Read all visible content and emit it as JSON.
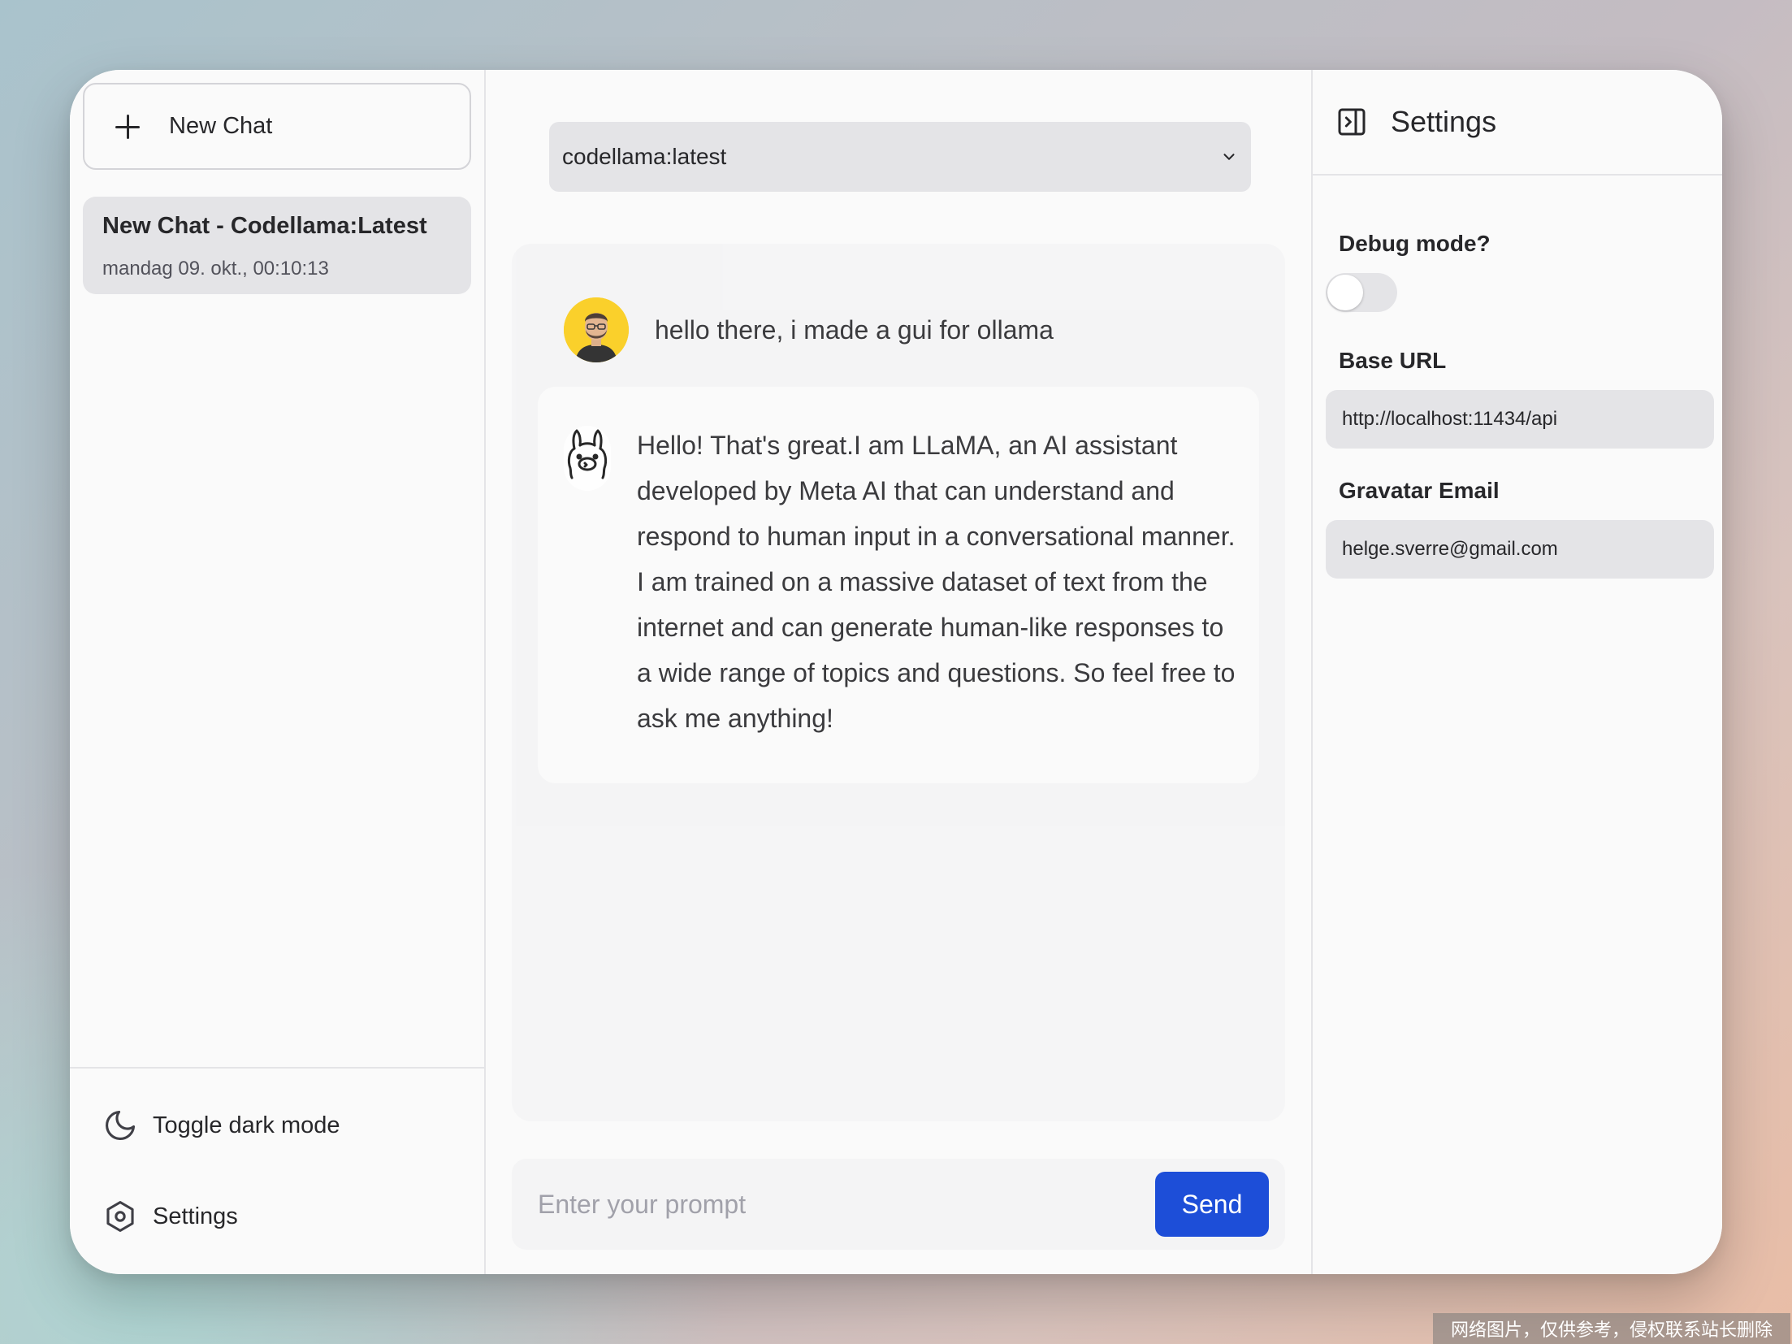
{
  "sidebar": {
    "new_chat_label": "New Chat",
    "chats": [
      {
        "title": "New Chat - Codellama:Latest",
        "date": "mandag 09. okt., 00:10:13"
      }
    ],
    "toggle_dark_label": "Toggle dark mode",
    "settings_label": "Settings"
  },
  "main": {
    "model": "codellama:latest",
    "messages": [
      {
        "role": "user",
        "text": "hello there, i made a gui for ollama"
      },
      {
        "role": "assistant",
        "text": "Hello! That's great.I am LLaMA, an AI assistant developed by Meta AI that can understand and respond to human input in a conversational manner. I am trained on a massive dataset of text from the internet and can generate human-like responses to a wide range of topics and questions. So feel free to ask me anything!"
      }
    ],
    "prompt_placeholder": "Enter your prompt",
    "prompt_value": "",
    "send_label": "Send"
  },
  "settings": {
    "title": "Settings",
    "debug_label": "Debug mode?",
    "debug_enabled": false,
    "base_url_label": "Base URL",
    "base_url_value": "http://localhost:11434/api",
    "gravatar_label": "Gravatar Email",
    "gravatar_value": "helge.sverre@gmail.com"
  },
  "colors": {
    "accent": "#1d4ed8",
    "avatar_bg": "#facc15"
  },
  "watermark": "网络图片，仅供参考，侵权联系站长删除"
}
